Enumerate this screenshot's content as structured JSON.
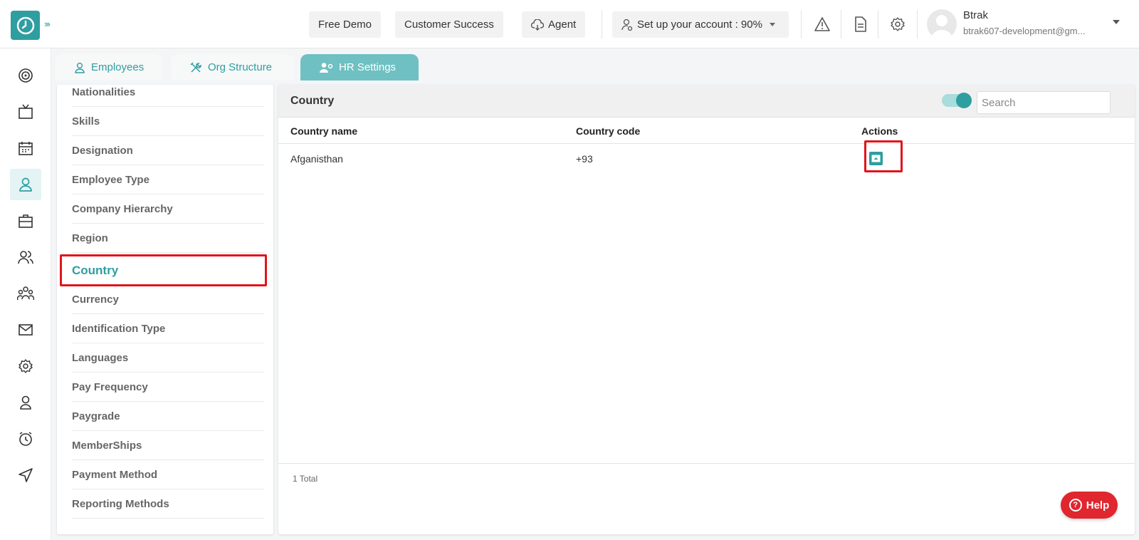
{
  "header": {
    "free_demo": "Free Demo",
    "customer_success": "Customer Success",
    "agent": "Agent",
    "setup_account": "Set up your account : 90%",
    "user_name": "Btrak",
    "user_email": "btrak607-development@gm..."
  },
  "tabs": {
    "employees": "Employees",
    "org_structure": "Org Structure",
    "hr_settings": "HR Settings"
  },
  "settings_menu": {
    "items": [
      "Nationalities",
      "Skills",
      "Designation",
      "Employee Type",
      "Company Hierarchy",
      "Region",
      "Country",
      "Currency",
      "Identification Type",
      "Languages",
      "Pay Frequency",
      "Paygrade",
      "MemberShips",
      "Payment Method",
      "Reporting Methods"
    ],
    "selected": "Country"
  },
  "panel": {
    "title": "Country",
    "search_placeholder": "Search",
    "columns": [
      "Country name",
      "Country code",
      "Actions"
    ],
    "rows": [
      {
        "country_name": "Afganisthan",
        "country_code": "+93"
      }
    ],
    "total": "1 Total"
  },
  "help": {
    "label": "Help"
  },
  "colors": {
    "accent": "#2e9ea1",
    "highlight": "#e0141c",
    "help": "#e0262e"
  }
}
